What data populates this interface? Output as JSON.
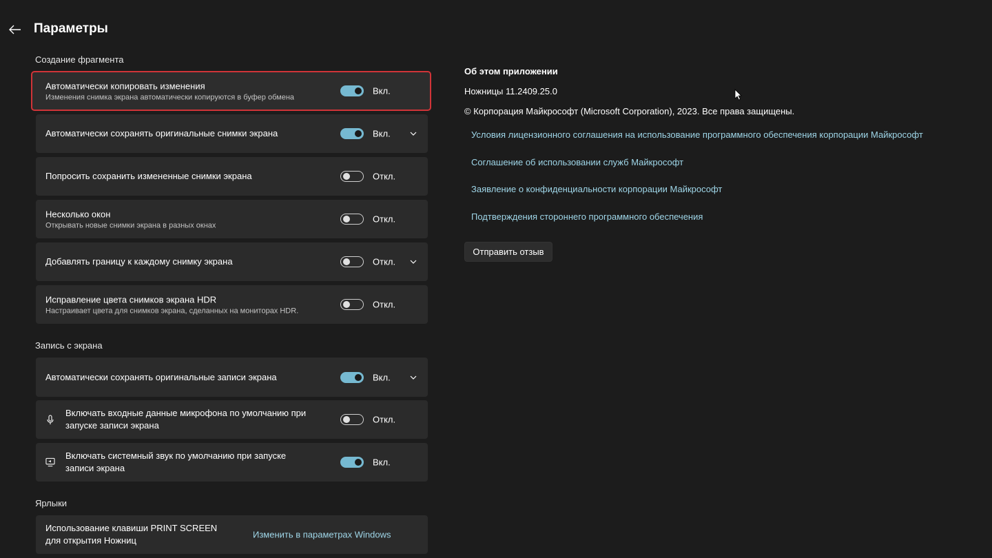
{
  "header": {
    "title": "Параметры"
  },
  "snip_section": {
    "title": "Создание фрагмента"
  },
  "snip_items": [
    {
      "title": "Автоматически копировать изменения",
      "subtitle": "Изменения снимка экрана автоматически копируются в буфер обмена",
      "state": "Вкл.",
      "on": true
    },
    {
      "title": "Автоматически сохранять оригинальные снимки экрана",
      "state": "Вкл.",
      "on": true
    },
    {
      "title": "Попросить сохранить измененные снимки экрана",
      "state": "Откл.",
      "on": false
    },
    {
      "title": "Несколько окон",
      "subtitle": "Открывать новые снимки экрана в разных окнах",
      "state": "Откл.",
      "on": false
    },
    {
      "title": "Добавлять границу к каждому снимку экрана",
      "state": "Откл.",
      "on": false
    },
    {
      "title": "Исправление цвета снимков экрана HDR",
      "subtitle": "Настраивает цвета для снимков экрана, сделанных на мониторах HDR.",
      "state": "Откл.",
      "on": false
    }
  ],
  "record_section": {
    "title": "Запись с экрана"
  },
  "record_items": [
    {
      "title": "Автоматически сохранять оригинальные записи экрана",
      "state": "Вкл.",
      "on": true
    },
    {
      "title": "Включать входные данные микрофона по умолчанию при запуске записи экрана",
      "state": "Откл.",
      "on": false,
      "icon": "microphone-icon"
    },
    {
      "title": "Включать системный звук по умолчанию при запуске записи экрана",
      "state": "Вкл.",
      "on": true,
      "icon": "system-audio-icon"
    }
  ],
  "shortcuts_section": {
    "title": "Ярлыки"
  },
  "shortcut_item": {
    "title": "Использование клавиши PRINT SCREEN для открытия Ножниц",
    "link": "Изменить в параметрах Windows"
  },
  "about": {
    "title": "Об этом приложении",
    "version": "Ножницы 11.2409.25.0",
    "copyright": "© Корпорация Майкрософт (Microsoft Corporation), 2023. Все права защищены.",
    "links": [
      "Условия лицензионного соглашения на использование программного обеспечения корпорации Майкрософт",
      "Соглашение об использовании служб Майкрософт",
      "Заявление о конфиденциальности корпорации Майкрософт",
      "Подтверждения стороннего программного обеспечения"
    ],
    "feedback_button": "Отправить отзыв"
  },
  "colors": {
    "accent": "#76b9d1",
    "link": "#9fd6e8",
    "highlight_border": "#d13438",
    "card_bg": "#2b2b2b",
    "page_bg": "#1c1c1c"
  }
}
